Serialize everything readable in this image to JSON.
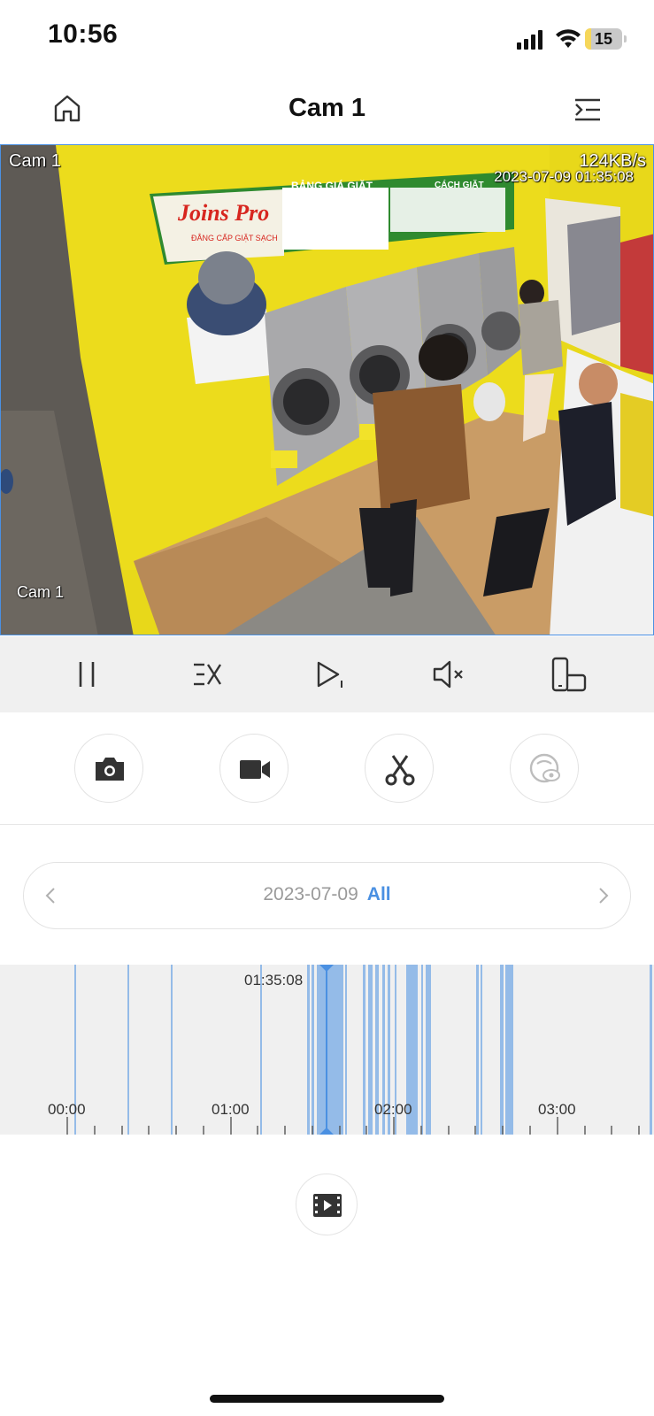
{
  "status_bar": {
    "time": "10:56",
    "battery_level": "15"
  },
  "nav": {
    "title": "Cam 1",
    "home_icon": "home-icon",
    "menu_icon": "menu-collapse-icon"
  },
  "video": {
    "osd_top_left": "Cam 1",
    "osd_bitrate": "124KB/s",
    "osd_timestamp": "2023-07-09 01:35:08",
    "osd_bottom_left": "Cam 1",
    "sign_brand": "Joins Pro",
    "sign_tagline": "ĐẲNG CẤP GIẶT SẠCH",
    "sign_price": "BẢNG GIÁ GIẶT",
    "sign_how": "CÁCH GIẶT"
  },
  "controls": {
    "pause_icon": "pause-icon",
    "speed_icon": "speed-icon",
    "step_icon": "step-forward-icon",
    "mute_icon": "mute-icon",
    "rotate_icon": "rotate-screen-icon"
  },
  "actions": {
    "snapshot_icon": "camera-icon",
    "record_icon": "video-camera-icon",
    "clip_icon": "scissors-icon",
    "privacy_icon": "privacy-eye-icon"
  },
  "date_selector": {
    "date": "2023-07-09",
    "filter": "All"
  },
  "timeline": {
    "playhead_time": "01:35:08",
    "labels": [
      "00:00",
      "01:00",
      "02:00",
      "03:00"
    ],
    "accent_color": "#4a90e2"
  },
  "film_icon": "film-play-icon"
}
